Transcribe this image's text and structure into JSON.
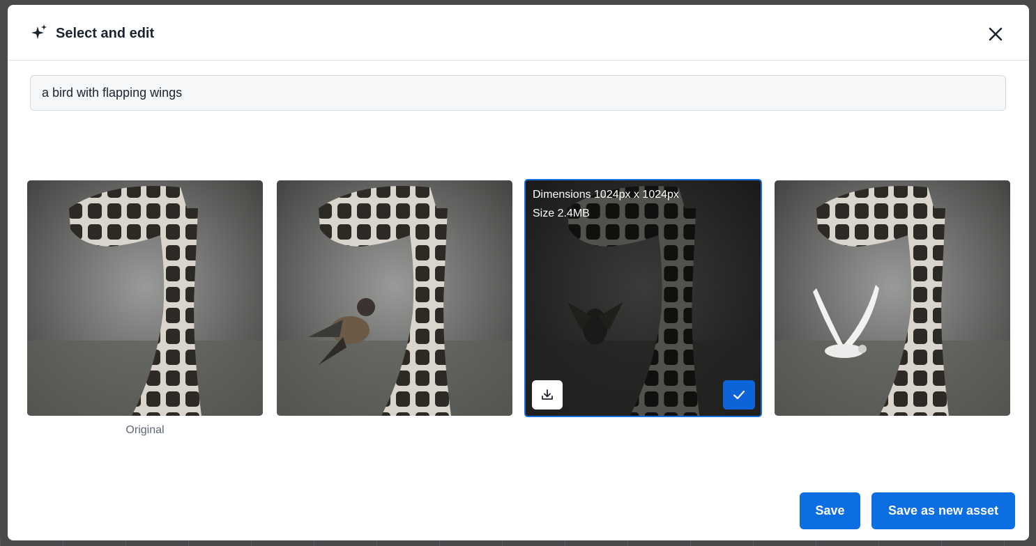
{
  "modal": {
    "title": "Select and edit",
    "prompt_value": "a bird with flapping wings"
  },
  "tiles": [
    {
      "caption": "Original",
      "bird": "none"
    },
    {
      "bird": "sparrow"
    },
    {
      "bird": "small-faint",
      "selected": true,
      "info": {
        "dimensions": "Dimensions 1024px x 1024px",
        "size": "Size 2.4MB"
      }
    },
    {
      "bird": "white-gull"
    }
  ],
  "footer": {
    "save_label": "Save",
    "save_new_label": "Save as new asset"
  },
  "colors": {
    "accent": "#0b6ee3",
    "selected_border": "#1b6fe0"
  },
  "icons": {
    "header": "sparkle-icon",
    "close": "close-icon",
    "download": "download-icon",
    "check": "check-icon"
  }
}
